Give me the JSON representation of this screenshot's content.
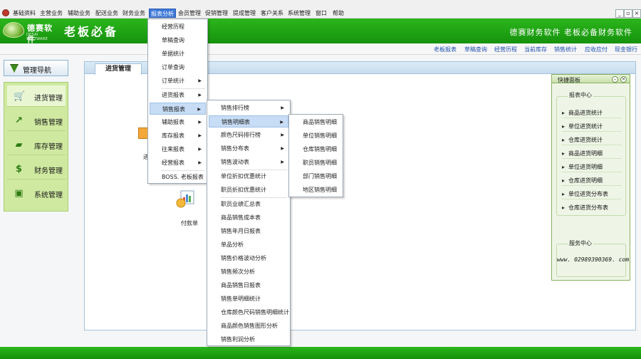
{
  "menubar": {
    "items": [
      "基础资料",
      "主营业务",
      "辅助业务",
      "配送业务",
      "财务业务",
      "报表分析",
      "会员管理",
      "促销管理",
      "提成管理",
      "客户关系",
      "系统管理",
      "窗口",
      "帮助"
    ],
    "active_index": 5,
    "window_controls": [
      "_",
      "▫",
      "×"
    ]
  },
  "header": {
    "logo_cn": "德赛软件",
    "logo_en": "DESAI SOFTWARE",
    "title": "老板必备",
    "slogan": "德赛财务软件  老板必备财务软件"
  },
  "quicklinks": [
    "老板报表",
    "草稿查询",
    "经营历程",
    "当前库存",
    "销售统计",
    "应收应付",
    "现金银行"
  ],
  "nav": {
    "header": "管理导航",
    "items": [
      {
        "label": "进货管理",
        "icon": "cart-icon",
        "active": true
      },
      {
        "label": "销售管理",
        "icon": "chart-up-icon",
        "active": false
      },
      {
        "label": "库存管理",
        "icon": "box-icon",
        "active": false
      },
      {
        "label": "财务管理",
        "icon": "dollar-icon",
        "active": false
      },
      {
        "label": "系统管理",
        "icon": "monitor-icon",
        "active": false
      }
    ]
  },
  "main": {
    "tab": "进货管理",
    "partial_label": "进",
    "payment_label": "付款单"
  },
  "menus": {
    "report": [
      "经营历程",
      "草稿查询",
      "单据统计",
      "订单查询",
      "订单统计",
      "进货报表",
      "销售报表",
      "辅助报表",
      "库存报表",
      "往来报表",
      "经营报表",
      "BOSS. 老板报表"
    ],
    "sales": [
      "销售排行榜",
      "销售明细表",
      "颜色尺码排行榜",
      "销售分布表",
      "销售波动表",
      "单位折扣优惠统计",
      "职员折扣优惠统计",
      "职员业绩汇总表",
      "商品销售成本表",
      "销售年月日报表",
      "单品分析",
      "销售价格波动分析",
      "销售频次分析",
      "商品销售日报表",
      "销售单明细统计",
      "仓库颜色尺码销售明细统计",
      "商品颜色销售图形分析",
      "销售利润分析"
    ],
    "detail": [
      "商品销售明细",
      "单位销售明细",
      "仓库销售明细",
      "职员销售明细",
      "部门销售明细",
      "地区销售明细"
    ]
  },
  "quickpanel": {
    "title": "快捷面板",
    "report_center": "报表中心",
    "links": [
      "商品进货统计",
      "单位进货统计",
      "仓库进货统计",
      "商品进货明细",
      "单位进货明细",
      "仓库进货明细",
      "单位进货分布表",
      "仓库进货分布表"
    ],
    "service_center": "服务中心",
    "phone": "www. 02989390369. com"
  }
}
